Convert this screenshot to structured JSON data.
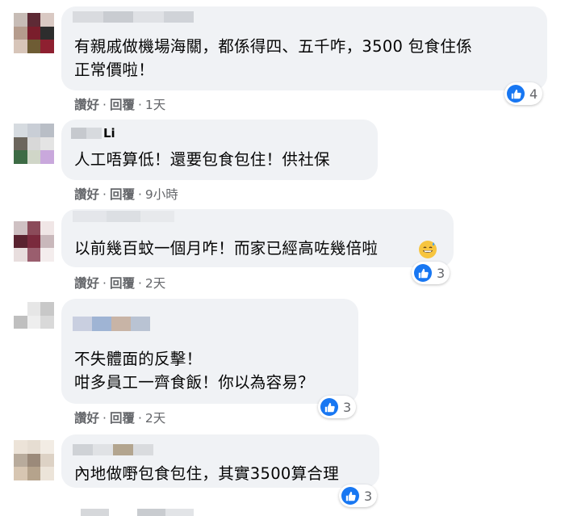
{
  "comments": [
    {
      "author": "",
      "text": "有親戚做機場海關，都係得四、五千咋，3500 包食住係\n正常價啦！",
      "like_label": "讚好",
      "reply_label": "回覆",
      "time": "1天",
      "reaction_count": "4",
      "avatar_colors": [
        "#c7bcb6",
        "#5e2a35",
        "#d9c9c3",
        "#b59c8d",
        "#7a1e2c",
        "#2d2d2d",
        "#d7c5b9",
        "#6e5c34",
        "#8e2030"
      ]
    },
    {
      "author": "Li",
      "text": "人工唔算低！還要包食包住！供社保",
      "like_label": "讚好",
      "reply_label": "回覆",
      "time": "9小時",
      "reaction_count": "",
      "avatar_colors": [
        "#d6dbe0",
        "#c9ced6",
        "#b9bec6",
        "#6c665d",
        "#d8d8d8",
        "#e4e4e4",
        "#3d6b45",
        "#d0d6c8",
        "#c9a8dc"
      ]
    },
    {
      "author": "",
      "text": "以前幾百蚊一個月咋！而家已經高咗幾倍啦",
      "like_label": "讚好",
      "reply_label": "回覆",
      "time": "2天",
      "reaction_count": "3",
      "avatar_colors": [
        "#cfc1c3",
        "#8b4b5a",
        "#f0e6e6",
        "#5a2330",
        "#7a2a3d",
        "#c9b8bb",
        "#e8dede",
        "#9a5e6e",
        "#f4eded"
      ]
    },
    {
      "author": "",
      "text": "不失體面的反擊！\n咁多員工一齊食飯！你以為容易？",
      "like_label": "讚好",
      "reply_label": "回覆",
      "time": "2天",
      "reaction_count": "3",
      "avatar_colors": [
        "#ffffff",
        "#e6e6e6",
        "#c8c8c8",
        "#bfbfbf",
        "#eeeeee",
        "#d9d9d9",
        "#ffffff",
        "#ffffff",
        "#ffffff"
      ]
    },
    {
      "author": "",
      "text": "內地做嘢包食包住，其實3500算合理",
      "like_label": "讚好",
      "reply_label": "回覆",
      "time": "",
      "reaction_count": "3",
      "avatar_colors": [
        "#ece3d8",
        "#e6ddd2",
        "#f2ece4",
        "#b8ab9c",
        "#9b8a7a",
        "#ddd2c5",
        "#d7c6b2",
        "#b5a38c",
        "#ece4d9"
      ]
    }
  ],
  "colors": {
    "bubble": "#f0f2f5",
    "like_blue": "#1877f2",
    "meta_gray": "#65676b"
  },
  "icons": {
    "like": "thumbs-up-icon",
    "emoji": "grinning-sweat-emoji-icon"
  }
}
